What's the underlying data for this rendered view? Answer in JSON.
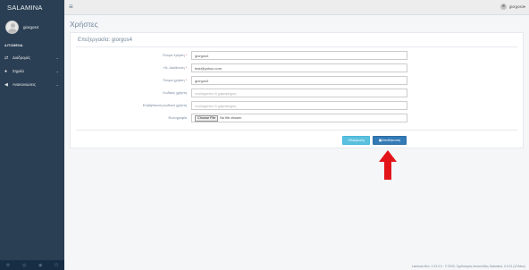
{
  "app": {
    "brand": "SALAMINA"
  },
  "profile": {
    "username": "giorgos4"
  },
  "sidebar": {
    "section_title": "ΑΙΤΟΜΕΝΑ",
    "items": [
      {
        "label": "Διαδρομές",
        "icon": "shuffle-icon"
      },
      {
        "label": "Σημεία",
        "icon": "map-marker-icon"
      },
      {
        "label": "Ανακοινώσεις",
        "icon": "bullhorn-icon"
      }
    ],
    "footer_icons": [
      "settings-icon",
      "fullscreen-icon",
      "lock-icon",
      "power-icon"
    ]
  },
  "topbar": {
    "user": "giorgos4"
  },
  "page": {
    "title": "Χρήστες"
  },
  "panel": {
    "title": "Επεξεργασία: giorgos4",
    "fields": {
      "username": {
        "label": "Όνομα Χρήστη",
        "value": "giorgos4"
      },
      "email": {
        "label": "Ηλ. Διεύθυνση",
        "value": "test@yahoo.com"
      },
      "fullname": {
        "label": "Όνομα χρήστη",
        "value": "giorgos4"
      },
      "password": {
        "label": "Κωδικός χρήστη",
        "placeholder": "τουλάχιστον 6 χαρακτήρες"
      },
      "password_confirm": {
        "label": "Επιβεβαίωση κωδικού χρήστη",
        "placeholder": "τουλάχιστον 6 χαρακτήρες"
      },
      "photo": {
        "label": "Φωτογραφία",
        "button": "Choose File",
        "status": "No file chosen"
      }
    },
    "buttons": {
      "cancel": "Ακύρωση",
      "save": "Αποθήκευση"
    }
  },
  "footer": {
    "text": "Laminas Mvc: 2.13 0.0 - © 2020, Σχεδιασμός Ιστοσελίδας Salamina. 0.5.21 (1/Video)"
  },
  "colors": {
    "sidebar": "#2a3f54",
    "primary": "#337ab7",
    "info": "#5bc0de",
    "arrow": "#e3151a"
  }
}
